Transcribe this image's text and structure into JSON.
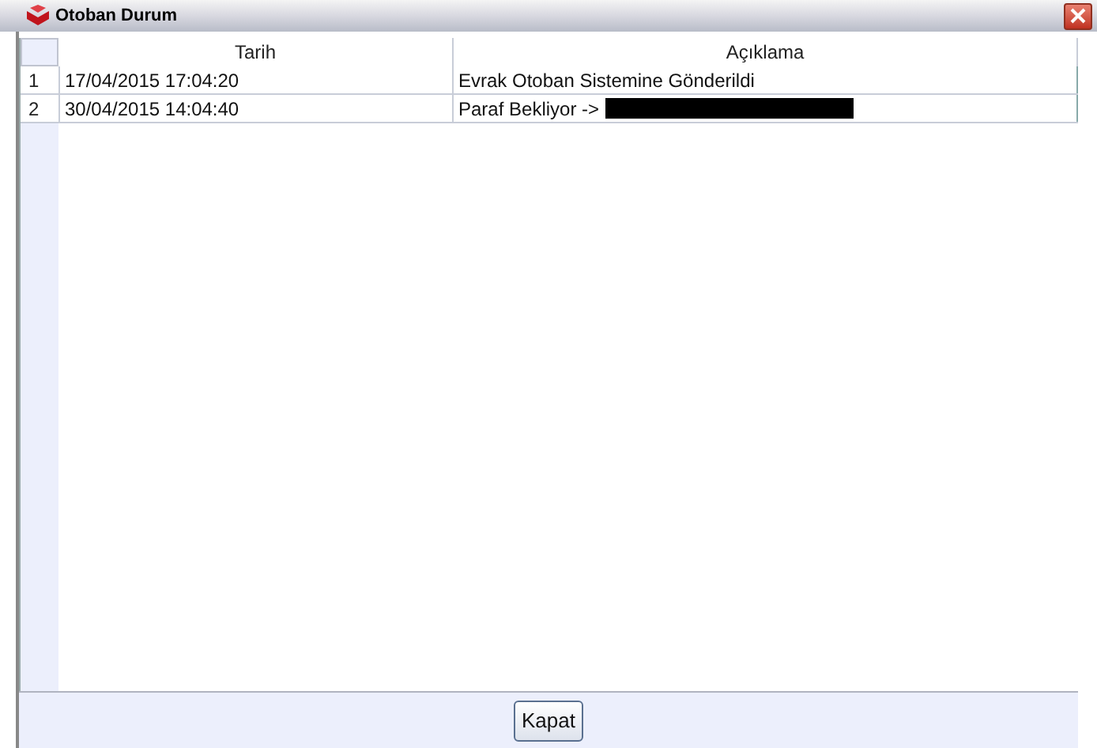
{
  "window": {
    "title": "Otoban Durum"
  },
  "table": {
    "columns": [
      "Tarih",
      "Açıklama"
    ],
    "rows": [
      {
        "number": "1",
        "tarih": "17/04/2015 17:04:20",
        "aciklama": "Evrak Otoban Sistemine Gönderildi",
        "redacted": false
      },
      {
        "number": "2",
        "tarih": "30/04/2015 14:04:40",
        "aciklama": "Paraf Bekliyor ->",
        "redacted": true
      }
    ]
  },
  "buttons": [
    {
      "label": "Kapat"
    }
  ]
}
